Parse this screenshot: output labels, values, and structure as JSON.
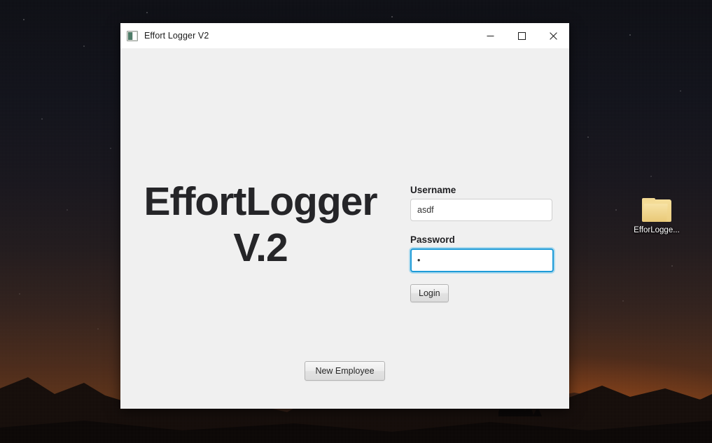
{
  "desktop": {
    "icon": {
      "name": "folder-icon",
      "label": "EfforLogge..."
    }
  },
  "window": {
    "title": "Effort Logger V2",
    "title_icon": "app-icon",
    "controls": {
      "minimize": "minimize-icon",
      "maximize": "maximize-icon",
      "close": "close-icon"
    }
  },
  "branding": {
    "line1": "EffortLogger",
    "line2": "V.2"
  },
  "form": {
    "username": {
      "label": "Username",
      "value": "asdf",
      "placeholder": ""
    },
    "password": {
      "label": "Password",
      "value": "•",
      "placeholder": "",
      "focused": true
    },
    "login_button": "Login"
  },
  "actions": {
    "new_employee_button": "New Employee"
  },
  "colors": {
    "focus_blue": "#1e9bd8",
    "window_body": "#f0f0f0",
    "title_bar": "#ffffff",
    "brand_text": "#252528",
    "folder_yellow": "#f0d48a"
  }
}
